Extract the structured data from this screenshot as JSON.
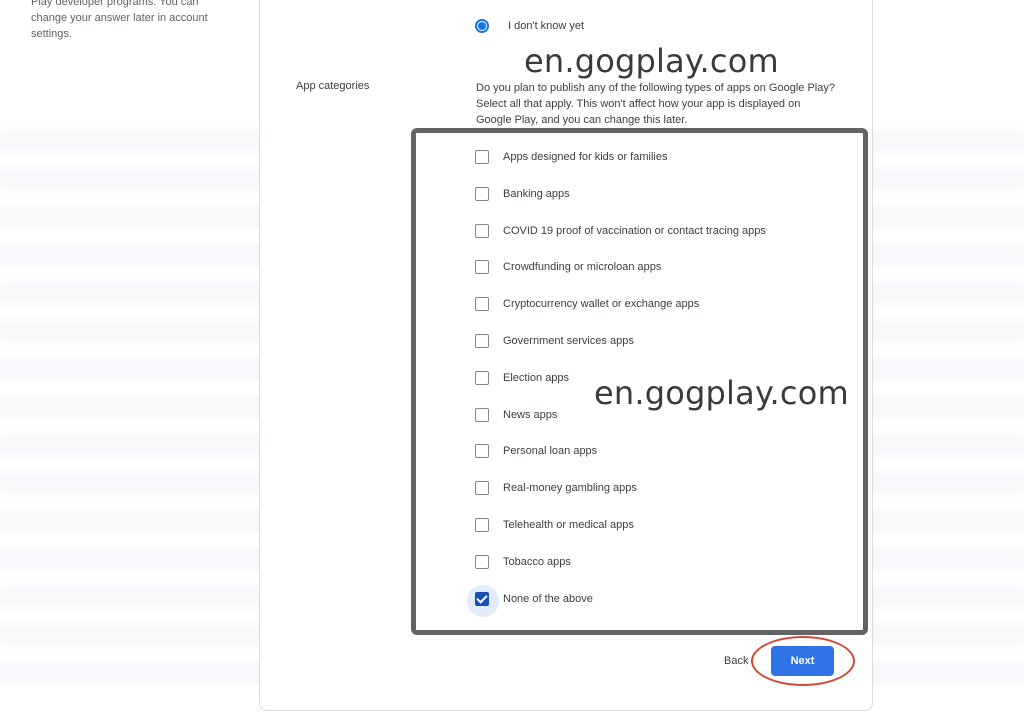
{
  "intro_text": "Play developer programs. You can change your answer later in account settings.",
  "radio_option": {
    "label": "I don't know yet",
    "selected": true
  },
  "watermark": "en.gogplay.com",
  "section": {
    "label": "App categories",
    "description": "Do you plan to publish any of the following types of apps on Google Play? Select all that apply. This won't affect how your app is displayed on Google Play, and you can change this later."
  },
  "categories": [
    {
      "label": "Apps designed for kids or families",
      "checked": false
    },
    {
      "label": "Banking apps",
      "checked": false
    },
    {
      "label": "COVID 19 proof of vaccination or contact tracing apps",
      "checked": false
    },
    {
      "label": "Crowdfunding or microloan apps",
      "checked": false
    },
    {
      "label": "Cryptocurrency wallet or exchange apps",
      "checked": false
    },
    {
      "label": "Government services apps",
      "checked": false
    },
    {
      "label": "Election apps",
      "checked": false
    },
    {
      "label": "News apps",
      "checked": false
    },
    {
      "label": "Personal loan apps",
      "checked": false
    },
    {
      "label": "Real-money gambling apps",
      "checked": false
    },
    {
      "label": "Telehealth or medical apps",
      "checked": false
    },
    {
      "label": "Tobacco apps",
      "checked": false
    },
    {
      "label": "None of the above",
      "checked": true
    }
  ],
  "buttons": {
    "back": "Back",
    "next": "Next"
  },
  "colors": {
    "accent": "#1a73e8",
    "next_button": "#2f73e6",
    "annotation_circle": "#d04a38",
    "annotation_box": "#646464"
  }
}
